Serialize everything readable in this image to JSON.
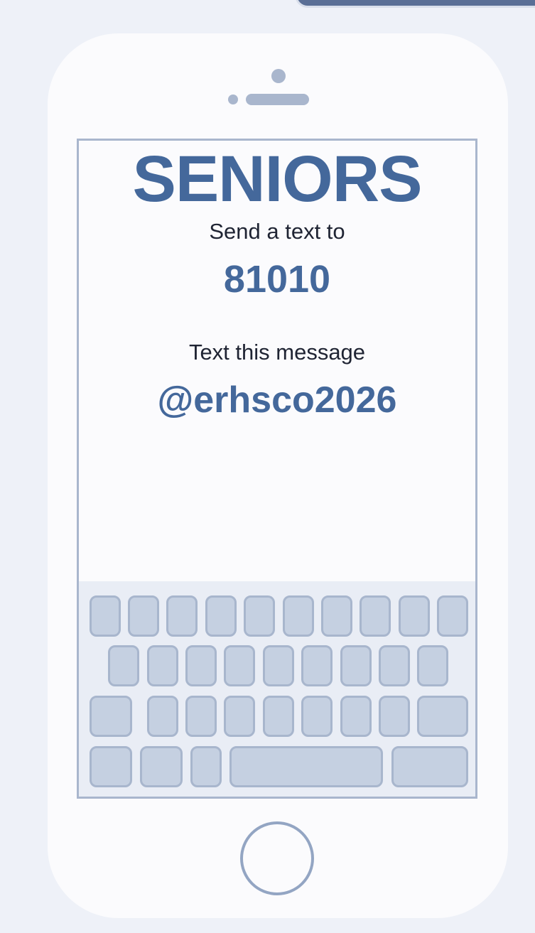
{
  "screen": {
    "title": "SENIORS",
    "send_label": "Send a text to",
    "number": "81010",
    "message_label": "Text this message",
    "message": "@erhsco2026"
  },
  "colors": {
    "background": "#eef1f8",
    "phone_body": "#fbfbfd",
    "outline": "#a9b6cd",
    "accent_text": "#44689b",
    "body_text": "#1f2433",
    "key_fill": "#c5d0e1",
    "keyboard_area": "#e9edf5"
  },
  "icons": [
    "sensor-dot-icon",
    "camera-dot-icon",
    "speaker-icon",
    "home-button-icon"
  ],
  "keyboard": {
    "rows": [
      {
        "name": "keyboard-row-1",
        "keys": 10
      },
      {
        "name": "keyboard-row-2",
        "keys": 9
      },
      {
        "name": "keyboard-row-3",
        "keys": 9
      },
      {
        "name": "keyboard-row-4",
        "keys": 5
      }
    ]
  }
}
